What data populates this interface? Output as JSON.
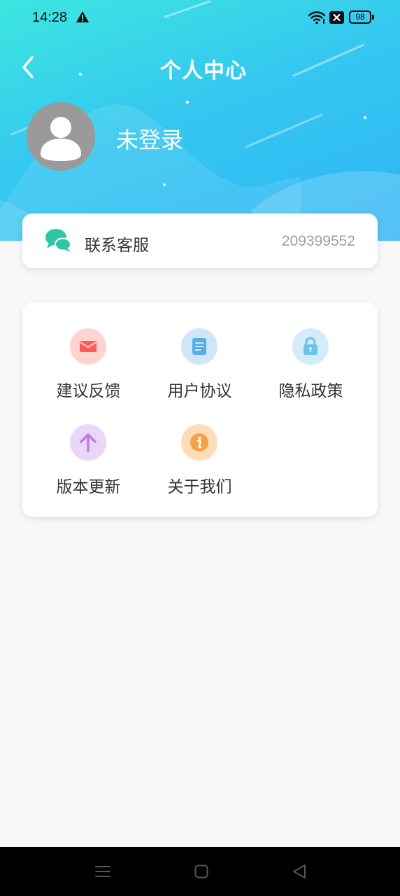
{
  "status_bar": {
    "time": "14:28",
    "battery": "98",
    "icons": [
      "warning-icon",
      "wifi-icon",
      "notification-x-icon",
      "battery-icon"
    ]
  },
  "header": {
    "back_icon": "chevron-left-icon",
    "title": "个人中心"
  },
  "profile": {
    "avatar_icon": "user-avatar-icon",
    "username": "未登录"
  },
  "contact": {
    "icon": "chat-bubbles-icon",
    "label": "联系客服",
    "number": "209399552"
  },
  "menu": {
    "items": [
      {
        "label": "建议反馈",
        "icon": "mail-icon",
        "color": "#ff6b6b",
        "bg": "#ffd3d0"
      },
      {
        "label": "用户协议",
        "icon": "document-icon",
        "color": "#5aaee8",
        "bg": "#cfe6f8"
      },
      {
        "label": "隐私政策",
        "icon": "lock-icon",
        "color": "#6cc4ee",
        "bg": "#d2ecf8"
      },
      {
        "label": "版本更新",
        "icon": "arrow-up-icon",
        "color": "#b77ee6",
        "bg": "#ead6f8"
      },
      {
        "label": "关于我们",
        "icon": "info-icon",
        "color": "#f5a04a",
        "bg": "#fddcb8"
      }
    ]
  },
  "nav_bar": {
    "icons": [
      "menu-icon",
      "home-icon",
      "back-icon"
    ]
  },
  "colors": {
    "header_gradient_start": "#3de6e0",
    "header_gradient_end": "#2fb4f5",
    "background": "#f8f8f8",
    "contact_icon": "#2ec7a6"
  }
}
